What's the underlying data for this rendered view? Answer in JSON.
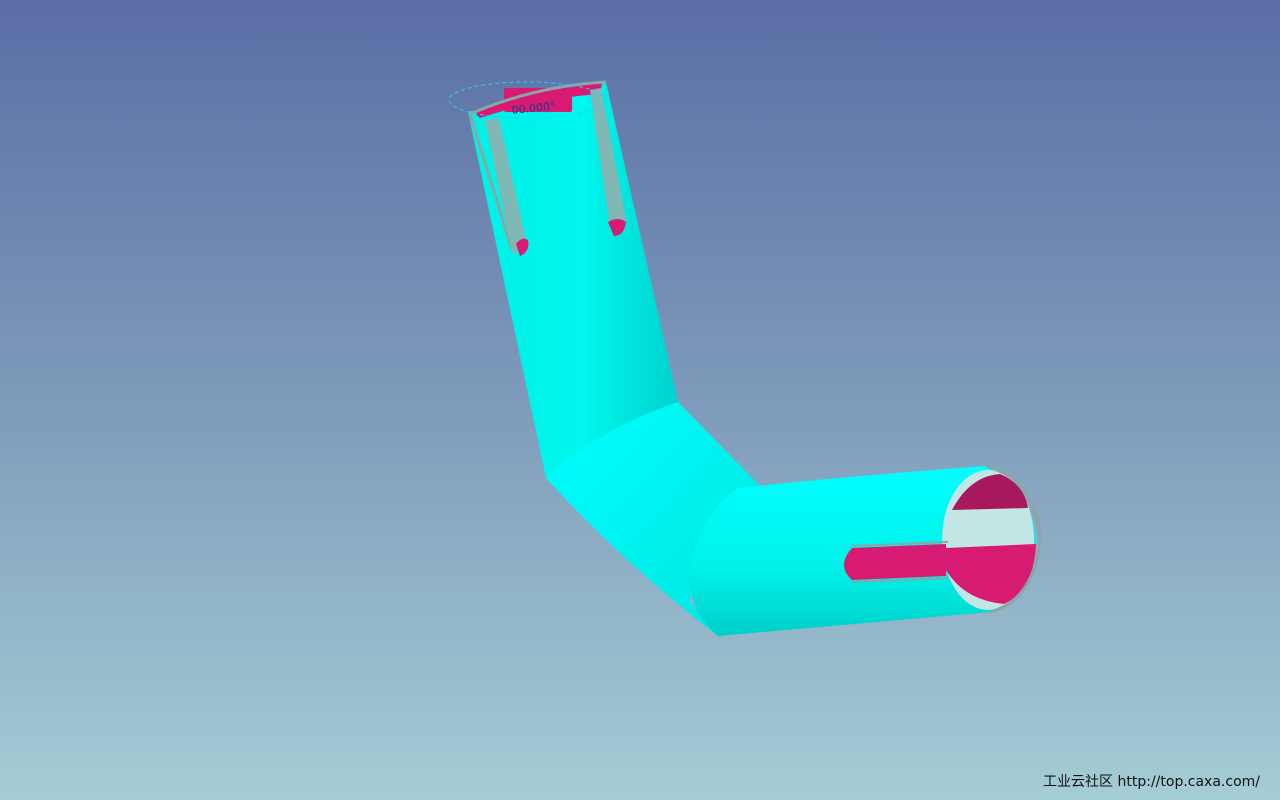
{
  "viewport": {
    "background_top": "#5a6ea6",
    "background_bottom": "#a4cdd5"
  },
  "model": {
    "body_color": "#00f0e6",
    "body_highlight_color": "#00ffff",
    "body_shadow_color": "#00d2cc",
    "cut_face_color": "#d81b72",
    "edge_color": "#8aa6a6",
    "dimension_text": "00.000°"
  },
  "watermark": {
    "text": "工业云社区 http://top.caxa.com/"
  }
}
